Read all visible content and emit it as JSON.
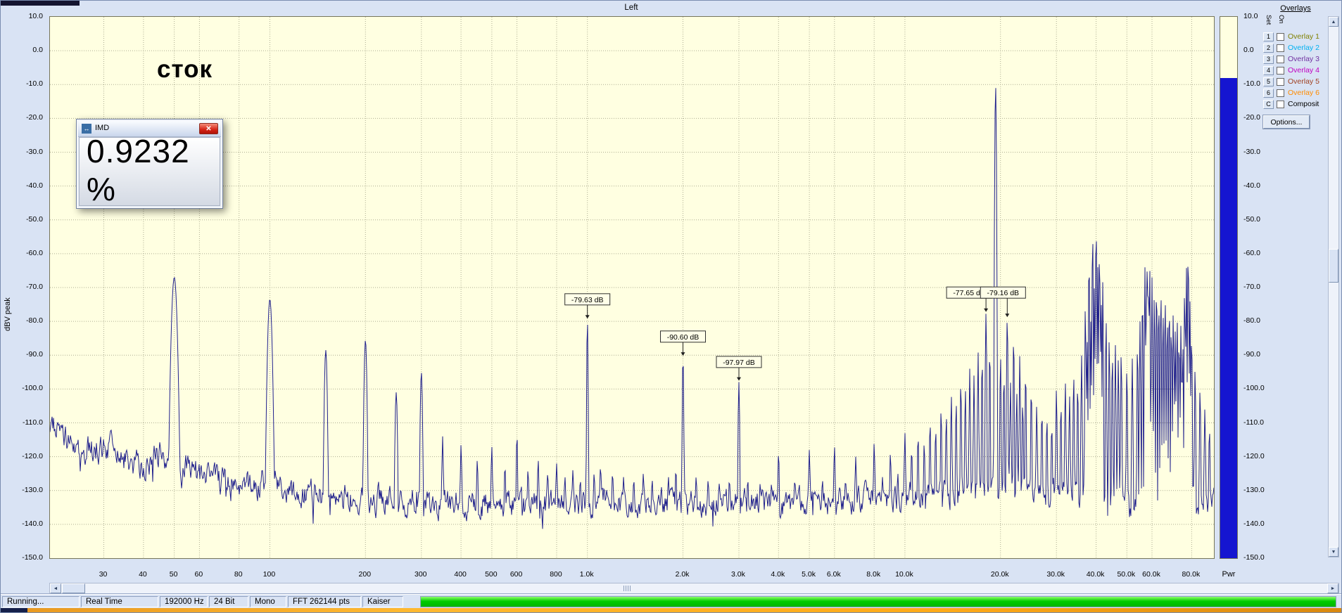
{
  "app": {
    "bg": "#d9e3f4"
  },
  "chart_data": {
    "type": "line",
    "title": "Left",
    "ylabel": "dBV peak",
    "x_scale": "log",
    "x_unit": "Hz",
    "x_range_hz": [
      20.3,
      94000
    ],
    "y_range_db": [
      -150,
      10
    ],
    "grid": true,
    "trace_color": "#20208c",
    "plot_bg": "#ffffe1",
    "y_ticks": [
      {
        "db": 10,
        "label": "10.0"
      },
      {
        "db": 0,
        "label": "0.0"
      },
      {
        "db": -10,
        "label": "-10.0"
      },
      {
        "db": -20,
        "label": "-20.0"
      },
      {
        "db": -30,
        "label": "-30.0"
      },
      {
        "db": -40,
        "label": "-40.0"
      },
      {
        "db": -50,
        "label": "-50.0"
      },
      {
        "db": -60,
        "label": "-60.0"
      },
      {
        "db": -70,
        "label": "-70.0"
      },
      {
        "db": -80,
        "label": "-80.0"
      },
      {
        "db": -90,
        "label": "-90.0"
      },
      {
        "db": -100,
        "label": "-100.0"
      },
      {
        "db": -110,
        "label": "-110.0"
      },
      {
        "db": -120,
        "label": "-120.0"
      },
      {
        "db": -130,
        "label": "-130.0"
      },
      {
        "db": -140,
        "label": "-140.0"
      },
      {
        "db": -150,
        "label": "-150.0"
      }
    ],
    "x_ticks": [
      {
        "f": 30,
        "label": "30"
      },
      {
        "f": 40,
        "label": "40"
      },
      {
        "f": 50,
        "label": "50"
      },
      {
        "f": 60,
        "label": "60"
      },
      {
        "f": 80,
        "label": "80"
      },
      {
        "f": 100,
        "label": "100"
      },
      {
        "f": 200,
        "label": "200"
      },
      {
        "f": 300,
        "label": "300"
      },
      {
        "f": 400,
        "label": "400"
      },
      {
        "f": 500,
        "label": "500"
      },
      {
        "f": 600,
        "label": "600"
      },
      {
        "f": 800,
        "label": "800"
      },
      {
        "f": 1000,
        "label": "1.0k"
      },
      {
        "f": 2000,
        "label": "2.0k"
      },
      {
        "f": 3000,
        "label": "3.0k"
      },
      {
        "f": 4000,
        "label": "4.0k"
      },
      {
        "f": 5000,
        "label": "5.0k"
      },
      {
        "f": 6000,
        "label": "6.0k"
      },
      {
        "f": 8000,
        "label": "8.0k"
      },
      {
        "f": 10000,
        "label": "10.0k"
      },
      {
        "f": 20000,
        "label": "20.0k"
      },
      {
        "f": 30000,
        "label": "30.0k"
      },
      {
        "f": 40000,
        "label": "40.0k"
      },
      {
        "f": 50000,
        "label": "50.0k"
      },
      {
        "f": 60000,
        "label": "60.0k"
      },
      {
        "f": 80000,
        "label": "80.0k"
      }
    ],
    "noise_floor_db": [
      [
        20,
        -109
      ],
      [
        23,
        -116
      ],
      [
        26,
        -119
      ],
      [
        30,
        -116
      ],
      [
        34,
        -121
      ],
      [
        40,
        -122
      ],
      [
        46,
        -119
      ],
      [
        55,
        -124
      ],
      [
        65,
        -127
      ],
      [
        80,
        -129
      ],
      [
        100,
        -127
      ],
      [
        130,
        -131
      ],
      [
        180,
        -132
      ],
      [
        300,
        -134
      ],
      [
        600,
        -134
      ],
      [
        1200,
        -133
      ],
      [
        3000,
        -134
      ],
      [
        6000,
        -133
      ],
      [
        10000,
        -132
      ],
      [
        14000,
        -131
      ],
      [
        18000,
        -129
      ],
      [
        22000,
        -128
      ],
      [
        28000,
        -131
      ],
      [
        40000,
        -132
      ],
      [
        60000,
        -133
      ],
      [
        94000,
        -134
      ]
    ],
    "peaks_hz_db": [
      [
        50,
        -67,
        9
      ],
      [
        100,
        -73.5,
        7
      ],
      [
        150,
        -88.5,
        4
      ],
      [
        200,
        -85.5,
        4
      ],
      [
        250,
        -101,
        3
      ],
      [
        300,
        -95,
        3
      ],
      [
        350,
        -114
      ],
      [
        400,
        -116.5
      ],
      [
        450,
        -121
      ],
      [
        500,
        -117
      ],
      [
        550,
        -123
      ],
      [
        600,
        -113.5
      ],
      [
        650,
        -124
      ],
      [
        700,
        -121
      ],
      [
        750,
        -125
      ],
      [
        800,
        -122
      ],
      [
        850,
        -126
      ],
      [
        900,
        -124
      ],
      [
        950,
        -127
      ],
      [
        1000,
        -79.63,
        2
      ],
      [
        1050,
        -125
      ],
      [
        1100,
        -123
      ],
      [
        1200,
        -125
      ],
      [
        1300,
        -126
      ],
      [
        1400,
        -127
      ],
      [
        1500,
        -125
      ],
      [
        1600,
        -127
      ],
      [
        1800,
        -126
      ],
      [
        1900,
        -124
      ],
      [
        2000,
        -90.6,
        2
      ],
      [
        2200,
        -126
      ],
      [
        2400,
        -127
      ],
      [
        2600,
        -128
      ],
      [
        2800,
        -127
      ],
      [
        3000,
        -97.97,
        2
      ],
      [
        3200,
        -127
      ],
      [
        3500,
        -128
      ],
      [
        3800,
        -128
      ],
      [
        4000,
        -119
      ],
      [
        4500,
        -127
      ],
      [
        5000,
        -118
      ],
      [
        5500,
        -127
      ],
      [
        6000,
        -117
      ],
      [
        6500,
        -127
      ],
      [
        7000,
        -120
      ],
      [
        7500,
        -126
      ],
      [
        8000,
        -116
      ],
      [
        8500,
        -126
      ],
      [
        9000,
        -119
      ],
      [
        9500,
        -125
      ],
      [
        10000,
        -113
      ],
      [
        10500,
        -118
      ],
      [
        11000,
        -114
      ],
      [
        11500,
        -116
      ],
      [
        12000,
        -110
      ],
      [
        12500,
        -112
      ],
      [
        13000,
        -106
      ],
      [
        13500,
        -108
      ],
      [
        14000,
        -102
      ],
      [
        14500,
        -104
      ],
      [
        15000,
        -98
      ],
      [
        15500,
        -100
      ],
      [
        16000,
        -94
      ],
      [
        16500,
        -96
      ],
      [
        17000,
        -89
      ],
      [
        17500,
        -91
      ],
      [
        18000,
        -77.65,
        2
      ],
      [
        18500,
        -88
      ],
      [
        19300,
        -10.2,
        3
      ],
      [
        20000,
        -90
      ],
      [
        20500,
        -96
      ],
      [
        21000,
        -79.16,
        2
      ],
      [
        21500,
        -98
      ],
      [
        22000,
        -84
      ],
      [
        22500,
        -101
      ],
      [
        23000,
        -90
      ],
      [
        23500,
        -104
      ],
      [
        24000,
        -95
      ],
      [
        25000,
        -100
      ],
      [
        26000,
        -105
      ],
      [
        27000,
        -107
      ],
      [
        28000,
        -109
      ],
      [
        29000,
        -111
      ],
      [
        30000,
        -100
      ],
      [
        31000,
        -105
      ],
      [
        32000,
        -98
      ],
      [
        33000,
        -102
      ],
      [
        34000,
        -96
      ],
      [
        35000,
        -99
      ],
      [
        36000,
        -90
      ],
      [
        37000,
        -75
      ],
      [
        37500,
        -86
      ],
      [
        38000,
        -60
      ],
      [
        38500,
        -80
      ],
      [
        39000,
        -52
      ],
      [
        39500,
        -70
      ],
      [
        40000,
        -50
      ],
      [
        40500,
        -64
      ],
      [
        41000,
        -58
      ],
      [
        41500,
        -74
      ],
      [
        42000,
        -68
      ],
      [
        43000,
        -79
      ],
      [
        44000,
        -85
      ],
      [
        45000,
        -90
      ],
      [
        46000,
        -87
      ],
      [
        47000,
        -91
      ],
      [
        48000,
        -89
      ],
      [
        50000,
        -94
      ],
      [
        52000,
        -91
      ],
      [
        54000,
        -87
      ],
      [
        55000,
        -80
      ],
      [
        56000,
        -72
      ],
      [
        57000,
        -64
      ],
      [
        57500,
        -76
      ],
      [
        58000,
        -61
      ],
      [
        58500,
        -73
      ],
      [
        59000,
        -63
      ],
      [
        60000,
        -67
      ],
      [
        61000,
        -72
      ],
      [
        62000,
        -69
      ],
      [
        63000,
        -74
      ],
      [
        64000,
        -71
      ],
      [
        65000,
        -77
      ],
      [
        66000,
        -73
      ],
      [
        67000,
        -79
      ],
      [
        68000,
        -75
      ],
      [
        69000,
        -81
      ],
      [
        70000,
        -77
      ],
      [
        71000,
        -83
      ],
      [
        72000,
        -79
      ],
      [
        73000,
        -85
      ],
      [
        74000,
        -81
      ],
      [
        75000,
        -87
      ],
      [
        76000,
        -70
      ],
      [
        77000,
        -64
      ],
      [
        78000,
        -58
      ],
      [
        79000,
        -74
      ],
      [
        80000,
        -84
      ],
      [
        82000,
        -94
      ],
      [
        85000,
        -100
      ],
      [
        88000,
        -106
      ],
      [
        91000,
        -112
      ]
    ],
    "markers": [
      {
        "f": 1000,
        "db": -79.63,
        "label": "-79.63 dB",
        "bdx": 0,
        "bdb": -73.5
      },
      {
        "f": 2000,
        "db": -90.6,
        "label": "-90.60 dB",
        "bdx": 0,
        "bdb": -84.5
      },
      {
        "f": 3000,
        "db": -97.97,
        "label": "-97.97 dB",
        "bdx": 0,
        "bdb": -92
      },
      {
        "f": 18000,
        "db": -77.65,
        "label": "-77.65 dB",
        "bdx": -24,
        "bdb": -71.5
      },
      {
        "f": 21000,
        "db": -79.16,
        "label": "-79.16 dB",
        "bdx": -6,
        "bdb": -71.5
      }
    ]
  },
  "annotation": {
    "text": "сток"
  },
  "imd_dialog": {
    "title": "IMD",
    "value": "0.9232 %"
  },
  "overlays": {
    "title": "Overlays",
    "col_set": "Set",
    "col_on": "On",
    "options_label": "Options...",
    "items": [
      {
        "key": "1",
        "label": "Overlay 1",
        "color": "#808000"
      },
      {
        "key": "2",
        "label": "Overlay 2",
        "color": "#00b0f0"
      },
      {
        "key": "3",
        "label": "Overlay 3",
        "color": "#7030a0"
      },
      {
        "key": "4",
        "label": "Overlay 4",
        "color": "#c000c0"
      },
      {
        "key": "5",
        "label": "Overlay 5",
        "color": "#a04020"
      },
      {
        "key": "6",
        "label": "Overlay 6",
        "color": "#ff8c00"
      },
      {
        "key": "C",
        "label": "Composit",
        "color": "#000000"
      }
    ]
  },
  "meter": {
    "label": "Pwr",
    "value_db": -8,
    "fill_color": "#1515d0"
  },
  "statusbar": {
    "items": [
      "Running...",
      "Real Time",
      "192000 Hz",
      "24 Bit",
      "Mono",
      "FFT 262144 pts",
      "Kaiser"
    ],
    "level_color": "#00cc00"
  },
  "icons": {
    "close": "✕",
    "dialog": "↔",
    "left": "◄",
    "right": "►",
    "up": "▲",
    "down": "▼"
  }
}
